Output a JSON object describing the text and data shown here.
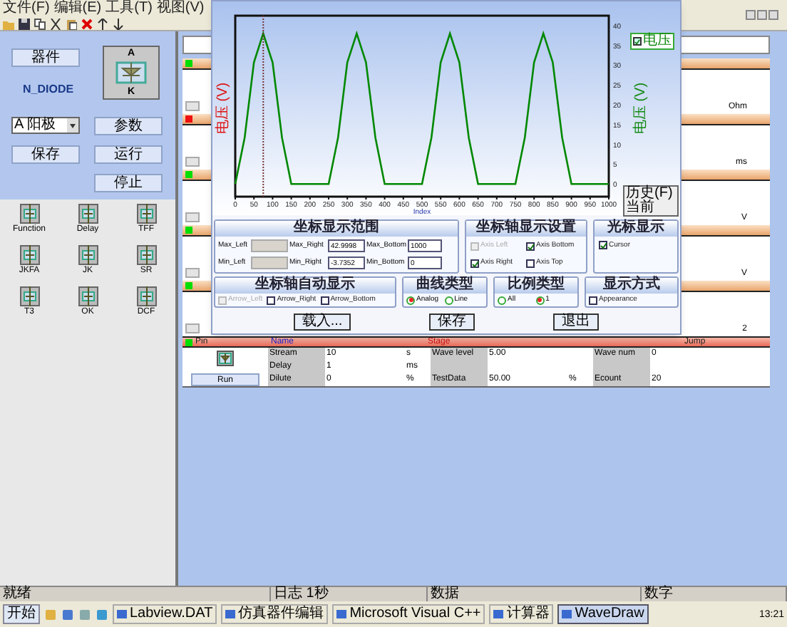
{
  "menu": [
    "文件(F)",
    "编辑(E)",
    "工具(T)",
    "视图(V)"
  ],
  "device_panel": {
    "title_button": "器件",
    "device_name": "N_DIODE",
    "anode": "A",
    "cathode": "K",
    "dropdown": "A 阳极",
    "buttons": [
      "参数",
      "保存",
      "运行",
      "停止"
    ]
  },
  "palette": [
    {
      "label": "Function"
    },
    {
      "label": "Delay"
    },
    {
      "label": "TFF"
    },
    {
      "label": "JKFA"
    },
    {
      "label": "JK"
    },
    {
      "label": "SR"
    },
    {
      "label": "T3"
    },
    {
      "label": "OK"
    },
    {
      "label": "DCF"
    }
  ],
  "list_rows": [
    {
      "color": "#00dd00",
      "unit": "Ohm"
    },
    {
      "color": "#ee1111",
      "unit": "ms"
    },
    {
      "color": "#00dd00",
      "unit": "V"
    },
    {
      "color": "#00dd00",
      "unit": "V"
    },
    {
      "color": "#00dd00",
      "unit": "2"
    }
  ],
  "chart_window": {
    "chart_data": {
      "type": "line",
      "xlabel": "Index",
      "ylabel": "电压 (V)",
      "x": [
        0,
        25,
        50,
        75,
        100,
        125,
        150,
        175,
        200,
        225,
        250,
        275,
        300,
        325,
        350,
        375,
        400,
        425,
        450,
        475,
        500,
        525,
        550,
        575,
        600,
        625,
        650,
        675,
        700,
        725,
        750,
        775,
        800,
        825,
        850,
        875,
        900,
        925,
        950,
        975,
        1000
      ],
      "series": [
        {
          "name": "电压",
          "color": "#008800",
          "values": [
            0,
            11.7,
            30.7,
            38,
            30.7,
            11.7,
            0,
            0,
            0,
            0,
            0,
            11.7,
            30.7,
            38,
            30.7,
            11.7,
            0,
            0,
            0,
            0,
            0,
            11.7,
            30.7,
            38,
            30.7,
            11.7,
            0,
            0,
            0,
            0,
            0,
            11.7,
            30.7,
            38,
            30.7,
            11.7,
            0,
            0,
            0,
            0,
            0
          ]
        }
      ],
      "xlim": [
        0,
        1000
      ],
      "ylim": [
        -3.2,
        42.5
      ],
      "xticks": [
        0,
        50,
        100,
        150,
        200,
        250,
        300,
        350,
        400,
        450,
        500,
        550,
        600,
        650,
        700,
        750,
        800,
        850,
        900,
        950,
        1000
      ],
      "yticks": [
        0,
        5,
        10,
        15,
        20,
        25,
        30,
        35,
        40
      ],
      "ref_lines": [
        {
          "axis": "x",
          "value": 75
        }
      ]
    },
    "right_axis_title": "电压 (V)",
    "legend_checked": true,
    "cursor_box": [
      "历史(F)",
      "当前"
    ],
    "range_group": {
      "title": "坐标显示范围",
      "fields": [
        {
          "label": "Max_Left",
          "disabled": true
        },
        {
          "label": "Max_Right",
          "value": "42.9998",
          "disabled": false
        },
        {
          "label": "Max_Bottom",
          "value": "1000",
          "disabled": false
        },
        {
          "label": "Min_Left",
          "disabled": true
        },
        {
          "label": "Min_Right",
          "value": "-3.7352",
          "disabled": false
        },
        {
          "label": "Min_Bottom",
          "value": "0",
          "disabled": false
        }
      ]
    },
    "axis_group": {
      "title": "坐标轴显示设置",
      "options": [
        {
          "label": "Axis Left",
          "checked": false,
          "disabled": true
        },
        {
          "label": "Axis Bottom",
          "checked": true,
          "disabled": false
        },
        {
          "label": "Axis Right",
          "checked": true,
          "disabled": false
        },
        {
          "label": "Axis Top",
          "checked": false,
          "disabled": false
        }
      ]
    },
    "cursor_group": {
      "title": "光标显示",
      "options": [
        {
          "label": "Cursor",
          "checked": true,
          "disabled": false
        }
      ]
    },
    "arrow_group": {
      "title": "坐标轴自动显示",
      "options": [
        {
          "label": "Arrow_Left",
          "checked": false,
          "disabled": true
        },
        {
          "label": "Arrow_Right",
          "checked": false,
          "disabled": false
        },
        {
          "label": "Arrow_Bottom",
          "checked": false,
          "disabled": false
        }
      ]
    },
    "curve_group": {
      "title": "曲线类型",
      "radios": [
        {
          "label": "Analog",
          "selected": true
        },
        {
          "label": "Line",
          "selected": false
        }
      ]
    },
    "scale_group": {
      "title": "比例类型",
      "radios": [
        {
          "label": "All",
          "selected": false
        },
        {
          "label": "1",
          "selected": true
        }
      ]
    },
    "display_group": {
      "title": "显示方式",
      "options": [
        {
          "label": "Appearance",
          "checked": false,
          "disabled": false
        }
      ]
    },
    "buttons": [
      "载入...",
      "保存",
      "退出"
    ]
  },
  "table": {
    "header": [
      "Pin",
      "Name",
      "Stage",
      "Jump"
    ],
    "color": "#00dd00",
    "run_button": "Run",
    "rows": [
      [
        "Stream",
        "10",
        "s",
        "Wave level",
        "5.00",
        "",
        "Wave num",
        "0"
      ],
      [
        "Delay",
        "1",
        "ms",
        "",
        "",
        "",
        "",
        ""
      ],
      [
        "Dilute",
        "0",
        "%",
        "TestData",
        "50.00",
        "%",
        "Ecount",
        "20"
      ]
    ]
  },
  "status_bar": [
    "就绪",
    "日志 1秒",
    "数据",
    "数字"
  ],
  "taskbar": {
    "start": "开始",
    "tasks": [
      {
        "label": "Labview.DAT",
        "selected": false
      },
      {
        "label": "仿真器件编辑",
        "selected": false
      },
      {
        "label": "Microsoft Visual C++",
        "selected": false
      },
      {
        "label": "计算器",
        "selected": false
      },
      {
        "label": "WaveDraw",
        "selected": true
      }
    ],
    "clock": "13:21"
  }
}
